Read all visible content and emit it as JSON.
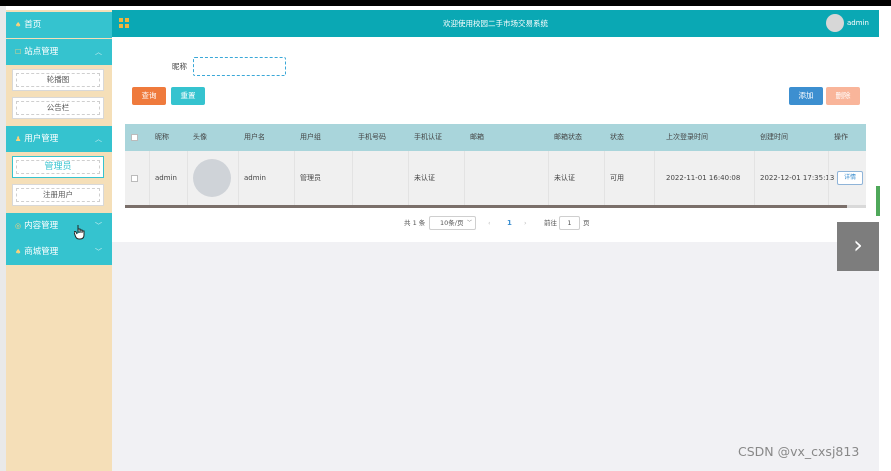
{
  "header": {
    "title": "欢迎使用校园二手市场交易系统",
    "user": "admin"
  },
  "sidebar": {
    "home": "首页",
    "groups": [
      {
        "label": "站点管理",
        "items": [
          "轮播图",
          "公告栏"
        ]
      },
      {
        "label": "用户管理",
        "items": [
          "管理员",
          "注册用户"
        ]
      },
      {
        "label": "内容管理",
        "items": []
      },
      {
        "label": "商城管理",
        "items": []
      }
    ]
  },
  "search": {
    "label": "昵称",
    "value": ""
  },
  "buttons": {
    "query": "查询",
    "reset": "重置",
    "add": "添加",
    "delete": "删除"
  },
  "table": {
    "headers": [
      "昵称",
      "头像",
      "用户名",
      "用户组",
      "手机号码",
      "手机认证",
      "邮箱",
      "邮箱状态",
      "状态",
      "上次登录时间",
      "创建时间",
      "操作"
    ],
    "rows": [
      {
        "nickname": "admin",
        "username": "admin",
        "group": "管理员",
        "phone": "",
        "phone_auth": "未认证",
        "email": "",
        "email_status": "未认证",
        "status": "可用",
        "last_login": "2022-11-01 16:40:08",
        "created": "2022-12-01 17:35:13",
        "action": "详情"
      }
    ]
  },
  "pagination": {
    "total": "共 1 条",
    "page_size": "10条/页",
    "prev": "‹",
    "page": "1",
    "next": "›",
    "goto": "前往",
    "goto_value": "1",
    "unit": "页"
  },
  "watermark": "CSDN @vx_cxsj813",
  "colors": {
    "accent": "#0aa8b4",
    "sidebar": "#f5dfb8",
    "menu": "#35c3cf"
  }
}
